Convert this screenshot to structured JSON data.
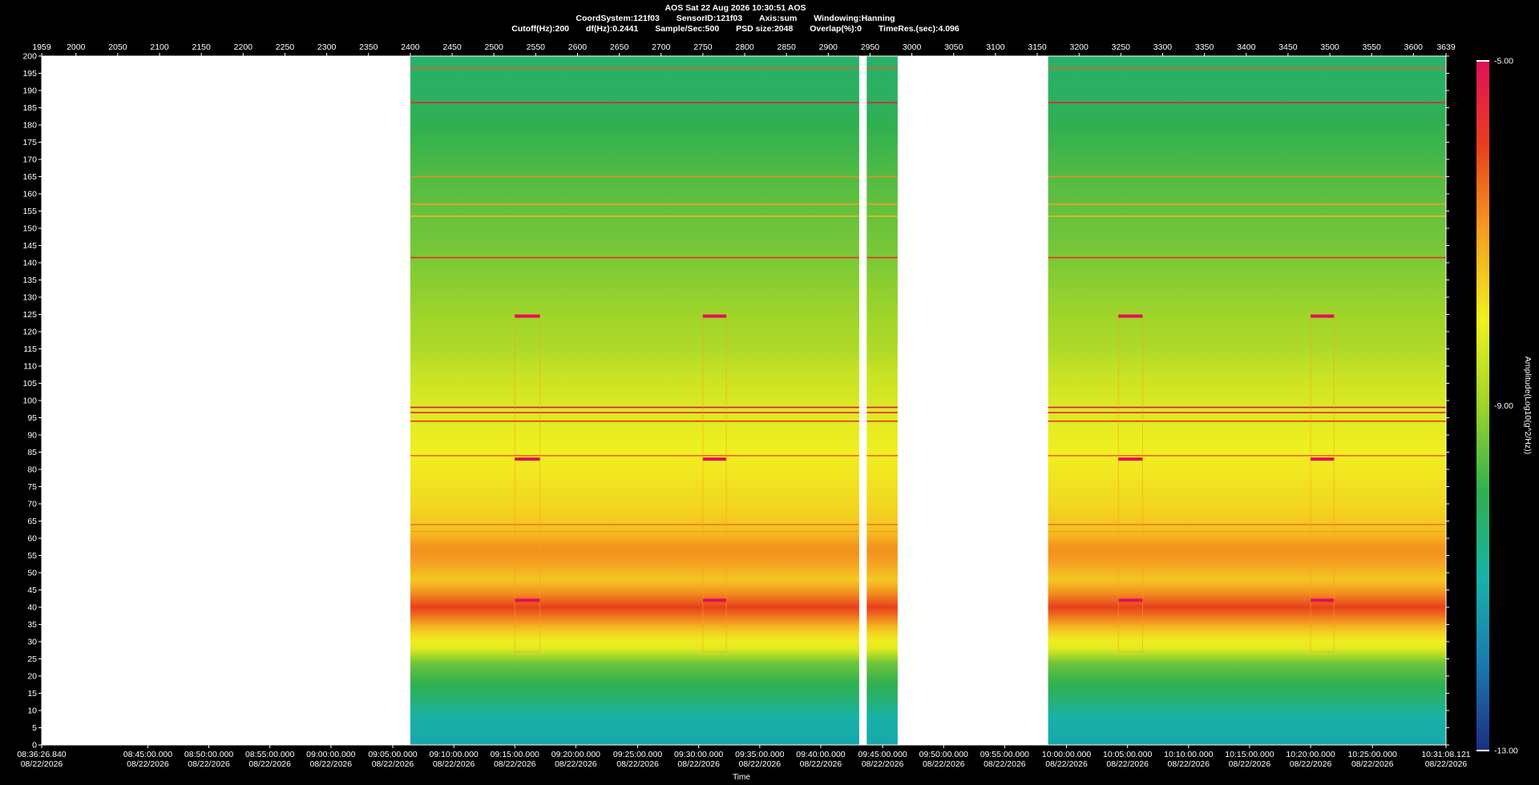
{
  "header": {
    "title": "AOS  Sat 22 Aug 2026 10:30:51  AOS",
    "line2": [
      "CoordSystem:121f03",
      "SensorID:121f03",
      "Axis:sum",
      "Windowing:Hanning"
    ],
    "line3": [
      "Cutoff(Hz):200",
      "df(Hz):0.2441",
      "Sample/Sec:500",
      "PSD size:2048",
      "Overlap(%):0",
      "TimeRes.(sec):4.096"
    ]
  },
  "colors": {
    "background": "#000000",
    "gap": "#ffffff"
  },
  "chart_data": {
    "type": "heatmap",
    "title": "",
    "xlabel": "Time",
    "ylabel": "",
    "ylim": [
      0,
      200
    ],
    "yticks": [
      0,
      5,
      10,
      15,
      20,
      25,
      30,
      35,
      40,
      45,
      50,
      55,
      60,
      65,
      70,
      75,
      80,
      85,
      90,
      95,
      100,
      105,
      110,
      115,
      120,
      125,
      130,
      135,
      140,
      145,
      150,
      155,
      160,
      165,
      170,
      175,
      180,
      185,
      190,
      195,
      200
    ],
    "top_axis": {
      "range": [
        1959,
        3639
      ],
      "ticks": [
        1959,
        2000,
        2050,
        2100,
        2150,
        2200,
        2250,
        2300,
        2350,
        2400,
        2450,
        2500,
        2550,
        2600,
        2650,
        2700,
        2750,
        2800,
        2850,
        2900,
        2950,
        3000,
        3050,
        3100,
        3150,
        3200,
        3250,
        3300,
        3350,
        3400,
        3450,
        3500,
        3550,
        3600,
        3639
      ]
    },
    "time_ticks": [
      {
        "sample": 1959,
        "time": "08:36:26.840",
        "date": "08/22/2026"
      },
      {
        "sample": 2086,
        "time": "08:45:00.000",
        "date": "08/22/2026"
      },
      {
        "sample": 2159,
        "time": "08:50:00.000",
        "date": "08/22/2026"
      },
      {
        "sample": 2232,
        "time": "08:55:00.000",
        "date": "08/22/2026"
      },
      {
        "sample": 2305,
        "time": "09:00:00.000",
        "date": "08/22/2026"
      },
      {
        "sample": 2379,
        "time": "09:05:00.000",
        "date": "08/22/2026"
      },
      {
        "sample": 2452,
        "time": "09:10:00.000",
        "date": "08/22/2026"
      },
      {
        "sample": 2525,
        "time": "09:15:00.000",
        "date": "08/22/2026"
      },
      {
        "sample": 2598,
        "time": "09:20:00.000",
        "date": "08/22/2026"
      },
      {
        "sample": 2672,
        "time": "09:25:00.000",
        "date": "08/22/2026"
      },
      {
        "sample": 2745,
        "time": "09:30:00.000",
        "date": "08/22/2026"
      },
      {
        "sample": 2818,
        "time": "09:35:00.000",
        "date": "08/22/2026"
      },
      {
        "sample": 2891,
        "time": "09:40:00.000",
        "date": "08/22/2026"
      },
      {
        "sample": 2965,
        "time": "09:45:00.000",
        "date": "08/22/2026"
      },
      {
        "sample": 3038,
        "time": "09:50:00.000",
        "date": "08/22/2026"
      },
      {
        "sample": 3111,
        "time": "09:55:00.000",
        "date": "08/22/2026"
      },
      {
        "sample": 3185,
        "time": "10:00:00.000",
        "date": "08/22/2026"
      },
      {
        "sample": 3258,
        "time": "10:05:00.000",
        "date": "08/22/2026"
      },
      {
        "sample": 3331,
        "time": "10:10:00.000",
        "date": "08/22/2026"
      },
      {
        "sample": 3404,
        "time": "10:15:00.000",
        "date": "08/22/2026"
      },
      {
        "sample": 3477,
        "time": "10:20:00.000",
        "date": "08/22/2026"
      },
      {
        "sample": 3551,
        "time": "10:25:00.000",
        "date": "08/22/2026"
      },
      {
        "sample": 3639,
        "time": "10:31:08.121",
        "date": "08/22/2026"
      }
    ],
    "data_segments": [
      {
        "start": 2400,
        "end": 2937
      },
      {
        "start": 2946,
        "end": 2983
      },
      {
        "start": 3163,
        "end": 3639
      }
    ],
    "colorbar": {
      "label": "Amplitude(Log10(g^2/Hz))",
      "min": -13.0,
      "max": -5.0,
      "ticks": [
        "-5.00",
        "-9.00",
        "-13.00"
      ],
      "colors": [
        "#1d2e80",
        "#1a7ab0",
        "#17b2a8",
        "#30b050",
        "#9ed42a",
        "#f0f020",
        "#f5a020",
        "#e8401c",
        "#e0105a"
      ]
    },
    "constant_lines_hz": [
      {
        "hz": 196.5,
        "level": -6.3
      },
      {
        "hz": 186.5,
        "level": -5.4
      },
      {
        "hz": 165.0,
        "level": -6.8
      },
      {
        "hz": 157.0,
        "level": -7.0
      },
      {
        "hz": 153.5,
        "level": -7.3
      },
      {
        "hz": 141.5,
        "level": -5.8
      },
      {
        "hz": 98.0,
        "level": -5.0
      },
      {
        "hz": 96.5,
        "level": -5.4
      },
      {
        "hz": 94.0,
        "level": -5.8
      },
      {
        "hz": 84.0,
        "level": -6.4
      },
      {
        "hz": 64.0,
        "level": -6.6
      },
      {
        "hz": 62.0,
        "level": -7.0
      }
    ],
    "events": [
      {
        "start": 2525,
        "end": 2555,
        "bands_hz": [
          124.5,
          83.0,
          42.0
        ]
      },
      {
        "start": 2750,
        "end": 2778,
        "bands_hz": [
          124.5,
          83.0,
          42.0
        ]
      },
      {
        "start": 3247,
        "end": 3276,
        "bands_hz": [
          124.5,
          83.0,
          42.0
        ]
      },
      {
        "start": 3477,
        "end": 3505,
        "bands_hz": [
          124.5,
          83.0,
          42.0
        ]
      }
    ]
  }
}
